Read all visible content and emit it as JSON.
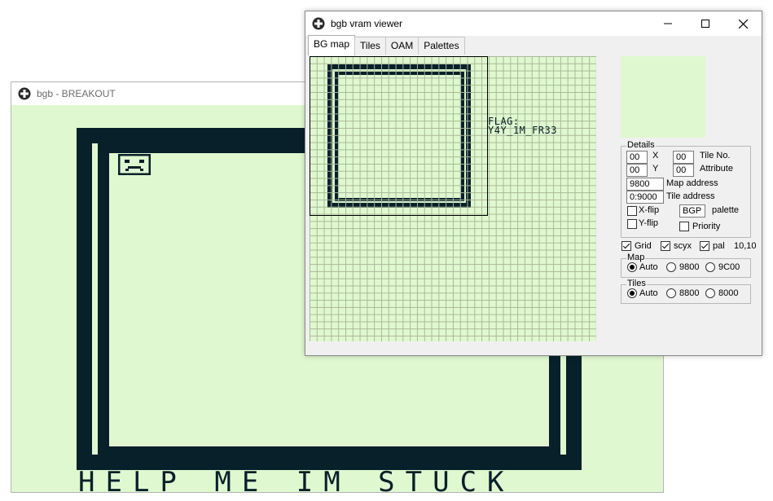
{
  "game_window": {
    "title": "bgb - BREAKOUT",
    "screen_text": "HELP ME IM STUCK"
  },
  "vram_window": {
    "title": "bgb vram viewer",
    "controls": {
      "minimize": "—",
      "maximize": "☐",
      "close": "✕"
    },
    "tabs": [
      "BG map",
      "Tiles",
      "OAM",
      "Palettes"
    ],
    "active_tab": "BG map",
    "map_text": "FLAG:\nY4Y_1M_FR33",
    "details": {
      "legend": "Details",
      "x_value": "00",
      "x_label": "X",
      "y_value": "00",
      "y_label": "Y",
      "tile_no_value": "00",
      "tile_no_label": "Tile No.",
      "attribute_value": "00",
      "attribute_label": "Attribute",
      "map_address_value": "9800",
      "map_address_label": "Map address",
      "tile_address_value": "0:9000",
      "tile_address_label": "Tile address",
      "xflip_label": "X-flip",
      "yflip_label": "Y-flip",
      "palette_value": "BGP",
      "palette_label": "palette",
      "priority_label": "Priority"
    },
    "options": {
      "grid_label": "Grid",
      "scyx_label": "scyx",
      "pal_label": "pal",
      "coords": "10,10"
    },
    "map_group": {
      "legend": "Map",
      "options": [
        "Auto",
        "9800",
        "9C00"
      ],
      "selected": "Auto"
    },
    "tiles_group": {
      "legend": "Tiles",
      "options": [
        "Auto",
        "8800",
        "8000"
      ],
      "selected": "Auto"
    }
  },
  "colors": {
    "gb_light": "#e0f8d0",
    "gb_dark": "#08202a"
  }
}
